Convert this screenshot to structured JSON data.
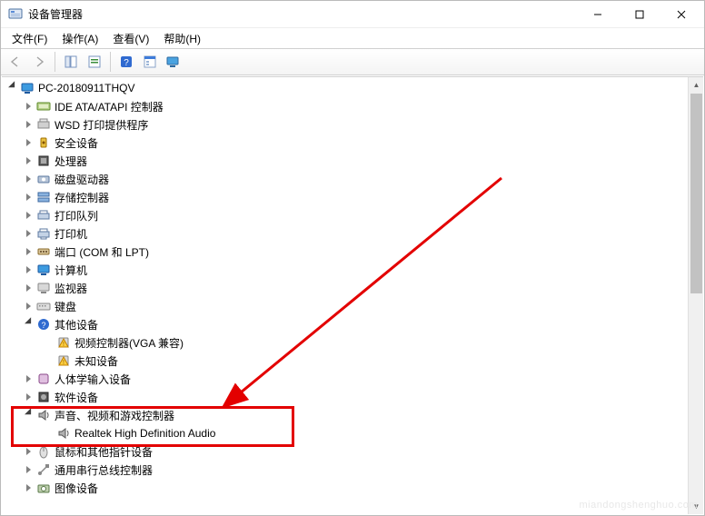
{
  "window": {
    "title": "设备管理器"
  },
  "menu": {
    "file": "文件(F)",
    "action": "操作(A)",
    "view": "查看(V)",
    "help": "帮助(H)"
  },
  "toolbar": {
    "back": "back",
    "forward": "forward",
    "show_hide": "show-hide",
    "refresh": "refresh",
    "help": "help",
    "properties": "properties",
    "monitor": "monitor"
  },
  "tree": {
    "root": {
      "label": "PC-20180911THQV"
    },
    "items": [
      {
        "label": "IDE ATA/ATAPI 控制器",
        "icon": "ide",
        "state": "collapsed"
      },
      {
        "label": "WSD 打印提供程序",
        "icon": "wsd",
        "state": "collapsed"
      },
      {
        "label": "安全设备",
        "icon": "security",
        "state": "collapsed"
      },
      {
        "label": "处理器",
        "icon": "cpu",
        "state": "collapsed"
      },
      {
        "label": "磁盘驱动器",
        "icon": "disk",
        "state": "collapsed"
      },
      {
        "label": "存储控制器",
        "icon": "storage",
        "state": "collapsed"
      },
      {
        "label": "打印队列",
        "icon": "printq",
        "state": "collapsed"
      },
      {
        "label": "打印机",
        "icon": "printer",
        "state": "collapsed"
      },
      {
        "label": "端口 (COM 和 LPT)",
        "icon": "port",
        "state": "collapsed"
      },
      {
        "label": "计算机",
        "icon": "computer",
        "state": "collapsed"
      },
      {
        "label": "监视器",
        "icon": "monitor",
        "state": "collapsed"
      },
      {
        "label": "键盘",
        "icon": "keyboard",
        "state": "collapsed"
      },
      {
        "label": "其他设备",
        "icon": "other",
        "state": "expanded",
        "children": [
          {
            "label": "视频控制器(VGA 兼容)",
            "icon": "warn"
          },
          {
            "label": "未知设备",
            "icon": "warn"
          }
        ]
      },
      {
        "label": "人体学输入设备",
        "icon": "hid",
        "state": "collapsed"
      },
      {
        "label": "软件设备",
        "icon": "software",
        "state": "collapsed"
      },
      {
        "label": "声音、视频和游戏控制器",
        "icon": "sound",
        "state": "expanded",
        "children": [
          {
            "label": "Realtek High Definition Audio",
            "icon": "sound"
          }
        ]
      },
      {
        "label": "鼠标和其他指针设备",
        "icon": "mouse",
        "state": "collapsed"
      },
      {
        "label": "通用串行总线控制器",
        "icon": "usb",
        "state": "collapsed"
      },
      {
        "label": "图像设备",
        "icon": "imaging",
        "state": "collapsed"
      }
    ]
  },
  "highlight": {
    "target_category": "声音、视频和游戏控制器",
    "target_child": "Realtek High Definition Audio"
  },
  "watermark": "miandongshenghuo.com"
}
